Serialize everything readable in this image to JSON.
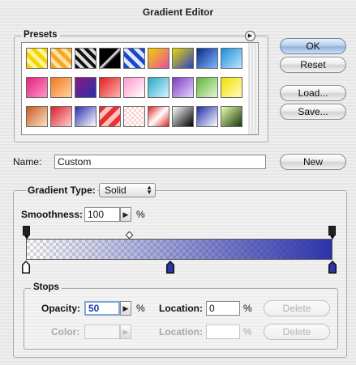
{
  "window": {
    "title": "Gradient Editor"
  },
  "presets": {
    "label": "Presets",
    "swatches": [
      {
        "bg": "repeating-linear-gradient(45deg,#f5d400 0 5px,#fff3a0 5px 10px)"
      },
      {
        "bg": "repeating-linear-gradient(45deg,#f5a623 0 5px,#ffe0a0 5px 10px)"
      },
      {
        "bg": "repeating-linear-gradient(45deg,#111 0 4px,#ddd 4px 8px)"
      },
      {
        "bg": "linear-gradient(135deg,#000 0%,#000 45%,#fff 50%,#000 60%)"
      },
      {
        "bg": "repeating-linear-gradient(45deg,#1b48c9 0 5px,#dfe8ff 5px 10px)"
      },
      {
        "bg": "linear-gradient(135deg,#f4d000,#e84aa4)"
      },
      {
        "bg": "linear-gradient(135deg,#e8d500,#2b41c8)"
      },
      {
        "bg": "linear-gradient(135deg,#0a2a8a,#7fb8ff)"
      },
      {
        "bg": "linear-gradient(135deg,#1a8cd8,#bfe6ff)"
      },
      {
        "bg": "linear-gradient(135deg,#e0217d,#ff96c8)"
      },
      {
        "bg": "linear-gradient(135deg,#f07a1c,#ffd2a0)"
      },
      {
        "bg": "linear-gradient(135deg,#8a1a7a,#2b2fb0)"
      },
      {
        "bg": "linear-gradient(135deg,#e21f1f,#ffb0b0)"
      },
      {
        "bg": "linear-gradient(135deg,#ff99cc,#ffffff)"
      },
      {
        "bg": "linear-gradient(135deg,#2aa8c9,#d6f4ff)"
      },
      {
        "bg": "linear-gradient(135deg,#7a3bbf,#e6d4ff)"
      },
      {
        "bg": "linear-gradient(135deg,#5eb53a,#e4f7d4)"
      },
      {
        "bg": "linear-gradient(135deg,#f3e000,#fffbc0)"
      },
      {
        "bg": "linear-gradient(135deg,#c55a1c,#ffe2c8)"
      },
      {
        "bg": "linear-gradient(135deg,#d81e2a,#ffd0d0)"
      },
      {
        "bg": "linear-gradient(135deg,#2b2fb0,#ffffff)"
      },
      {
        "bg": "repeating-linear-gradient(135deg,#e83030 0 6px,#ffc0c0 6px 12px)"
      },
      {
        "bg": "repeating-conic-gradient(#ffd0d0 0 25%,#fff 0 50%) 0 0/6px 6px"
      },
      {
        "bg": "linear-gradient(135deg,#e02020 0%,#fff 50%,#e02020 100%)"
      },
      {
        "bg": "linear-gradient(135deg,#ffffff,#000000)"
      },
      {
        "bg": "linear-gradient(135deg,#1b2ea8,#ffffff)"
      },
      {
        "bg": "linear-gradient(135deg,#e8ffb0,#1a3a0a)"
      }
    ]
  },
  "buttons": {
    "ok": "OK",
    "reset": "Reset",
    "load": "Load...",
    "save": "Save...",
    "new": "New"
  },
  "name_field": {
    "label": "Name:",
    "value": "Custom"
  },
  "gradient": {
    "type_label": "Gradient Type:",
    "type_value": "Solid",
    "smoothness_label": "Smoothness:",
    "smoothness_value": "100",
    "smoothness_unit": "%",
    "colors": {
      "start": "#ffffff",
      "end": "#2c34aa"
    }
  },
  "stops": {
    "label": "Stops",
    "opacity_label": "Opacity:",
    "opacity_value": "50",
    "opacity_unit": "%",
    "opacity_location_label": "Location:",
    "opacity_location_value": "0",
    "opacity_location_unit": "%",
    "opacity_delete": "Delete",
    "color_label": "Color:",
    "color_location_label": "Location:",
    "color_location_value": "",
    "color_location_unit": "%",
    "color_delete": "Delete"
  }
}
